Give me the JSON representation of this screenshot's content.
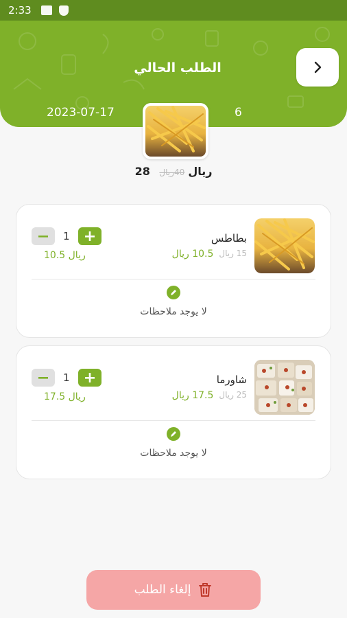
{
  "status_bar": {
    "time": "2:33"
  },
  "header": {
    "title": "الطلب الحالي",
    "date": "2023-07-17",
    "count": "6"
  },
  "order_summary": {
    "old_price": "40ريال",
    "new_price": "28 ريال"
  },
  "items": [
    {
      "name": "بطاطس",
      "old_price": "15 ريال",
      "new_price": "10.5 ريال",
      "quantity": "1",
      "total": "10.5 ريال",
      "note": "لا يوجد ملاحظات",
      "image": "fries"
    },
    {
      "name": "شاورما",
      "old_price": "25 ريال",
      "new_price": "17.5 ريال",
      "quantity": "1",
      "total": "17.5 ريال",
      "note": "لا يوجد ملاحظات",
      "image": "shawarma"
    }
  ],
  "actions": {
    "cancel_label": "إلغاء الطلب"
  },
  "colors": {
    "accent": "#7fb129",
    "status_bar": "#5f8c1f",
    "cancel": "#f5a6a6"
  },
  "icons": {
    "back": "chevron-right-icon",
    "plus": "plus-icon",
    "minus": "minus-icon",
    "note": "pencil-icon",
    "cancel": "trash-icon"
  }
}
